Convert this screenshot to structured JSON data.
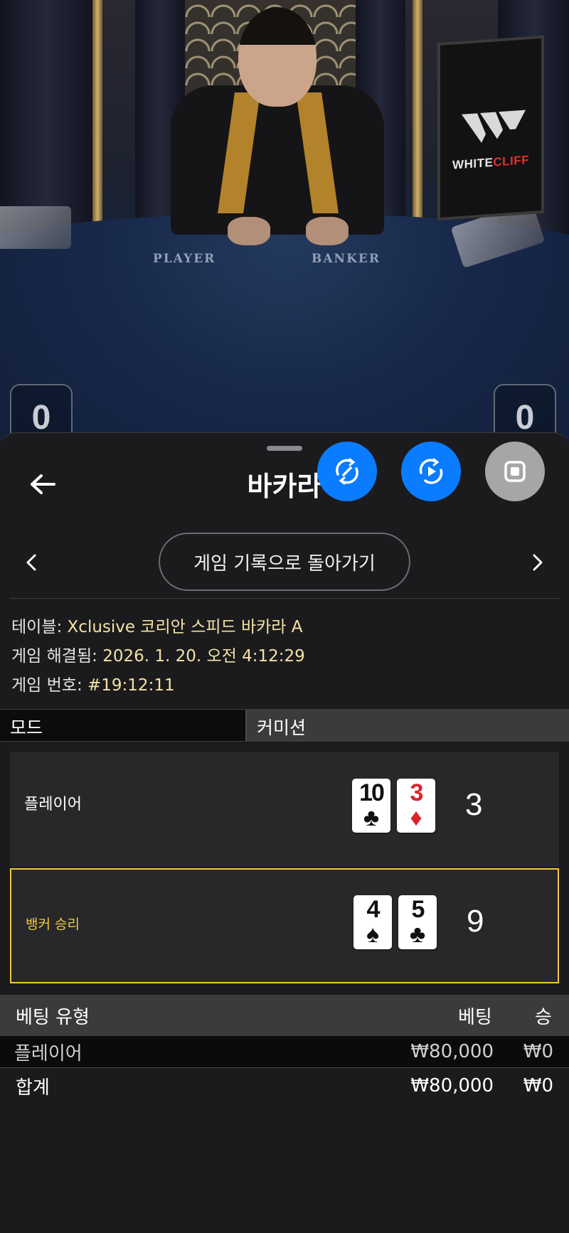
{
  "video": {
    "felt_player_label": "PLAYER",
    "felt_banker_label": "BANKER",
    "brand_logo_white": "WHITE",
    "brand_logo_red": "CLIFF",
    "player_score": "0",
    "banker_score": "0"
  },
  "header": {
    "title": "바카라",
    "fab_icons": [
      "sync-icon",
      "replay-icon",
      "stop-icon"
    ]
  },
  "history_nav": {
    "label": "게임 기록으로 돌아가기"
  },
  "info": {
    "table_label": "테이블:",
    "table_value": "Xclusive 코리안 스피드 바카라 A",
    "resolved_label": "게임 해결됨:",
    "resolved_value": "2026. 1. 20. 오전 4:12:29",
    "number_label": "게임 번호:",
    "number_value": "#19:12:11"
  },
  "mode": {
    "label": "모드",
    "value": "커미션"
  },
  "hands": {
    "player": {
      "label": "플레이어",
      "cards": [
        {
          "rank": "10",
          "suit": "♣",
          "color": "black"
        },
        {
          "rank": "3",
          "suit": "♦",
          "color": "red"
        }
      ],
      "total": "3"
    },
    "banker": {
      "label": "뱅커 승리",
      "cards": [
        {
          "rank": "4",
          "suit": "♠",
          "color": "black"
        },
        {
          "rank": "5",
          "suit": "♣",
          "color": "black"
        }
      ],
      "total": "9"
    }
  },
  "bets": {
    "headers": {
      "type": "베팅 유형",
      "bet": "베팅",
      "win": "승"
    },
    "rows": [
      {
        "type": "플레이어",
        "bet": "₩80,000",
        "win": "₩0"
      }
    ],
    "total": {
      "type": "합계",
      "bet": "₩80,000",
      "win": "₩0"
    }
  },
  "colors": {
    "accent_blue": "#0a7cff",
    "win_yellow": "#f0c93a",
    "info_value": "#f3e2a6",
    "logo_red": "#e0312b"
  }
}
